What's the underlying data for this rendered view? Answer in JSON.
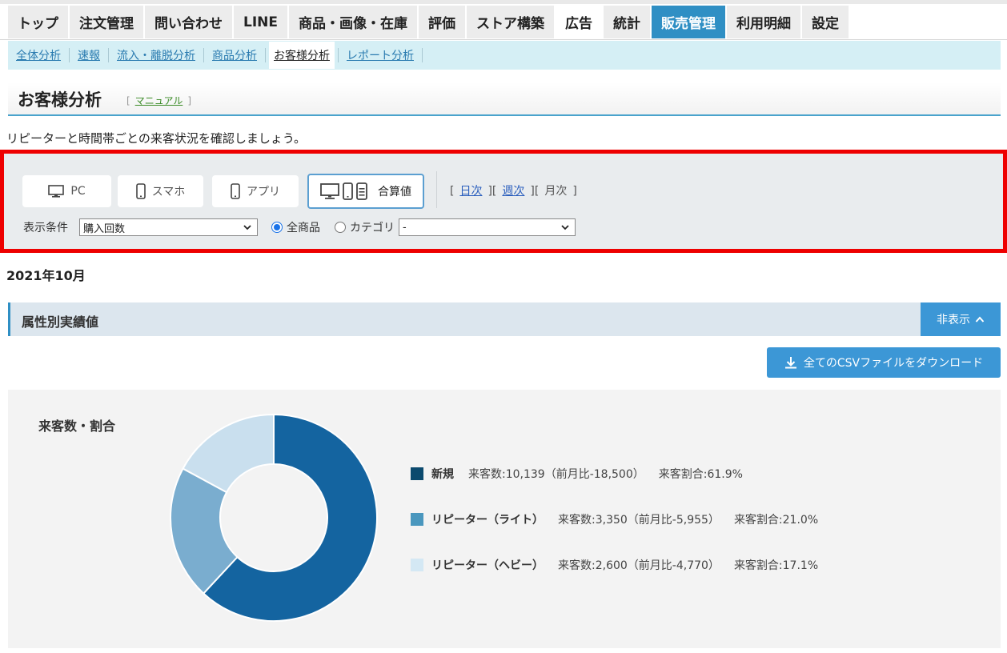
{
  "tabs": [
    "トップ",
    "注文管理",
    "問い合わせ",
    "LINE",
    "商品・画像・在庫",
    "評価",
    "ストア構築",
    "広告",
    "統計",
    "販売管理",
    "利用明細",
    "設定"
  ],
  "subnav": [
    "全体分析",
    "速報",
    "流入・離脱分析",
    "商品分析",
    "お客様分析",
    "レポート分析"
  ],
  "page": {
    "title": "お客様分析",
    "manual_label": "マニュアル",
    "description": "リピーターと時間帯ごとの来客状況を確認しましょう。"
  },
  "filter": {
    "devices": [
      "PC",
      "スマホ",
      "アプリ",
      "合算値"
    ],
    "period": {
      "daily": "日次",
      "weekly": "週次",
      "monthly": "月次"
    },
    "condition_label": "表示条件",
    "condition_value": "購入回数",
    "radio_all": "全商品",
    "radio_category": "カテゴリ",
    "category_value": "-"
  },
  "month": "2021年10月",
  "section": {
    "title": "属性別実績値",
    "hide_label": "非表示",
    "csv_label": "全てのCSVファイルをダウンロード"
  },
  "chart_title": "来客数・割合",
  "chart_data": {
    "type": "pie",
    "title": "来客数・割合",
    "categories": [
      "新規",
      "リピーター（ライト）",
      "リピーター（ヘビー）"
    ],
    "values": [
      61.9,
      21.0,
      17.1
    ],
    "colors": [
      "#1464a0",
      "#7aadcf",
      "#c9dfee"
    ],
    "legend": [
      {
        "name": "新規",
        "detail": "来客数:10,139（前月比-18,500）",
        "ratio": "来客割合:61.9%",
        "color": "#0b4a6e"
      },
      {
        "name": "リピーター（ライト）",
        "detail": "来客数:3,350（前月比-5,955）",
        "ratio": "来客割合:21.0%",
        "color": "#4a97be"
      },
      {
        "name": "リピーター（ヘビー）",
        "detail": "来客数:2,600（前月比-4,770）",
        "ratio": "来客割合:17.1%",
        "color": "#d4e8f4"
      }
    ]
  }
}
